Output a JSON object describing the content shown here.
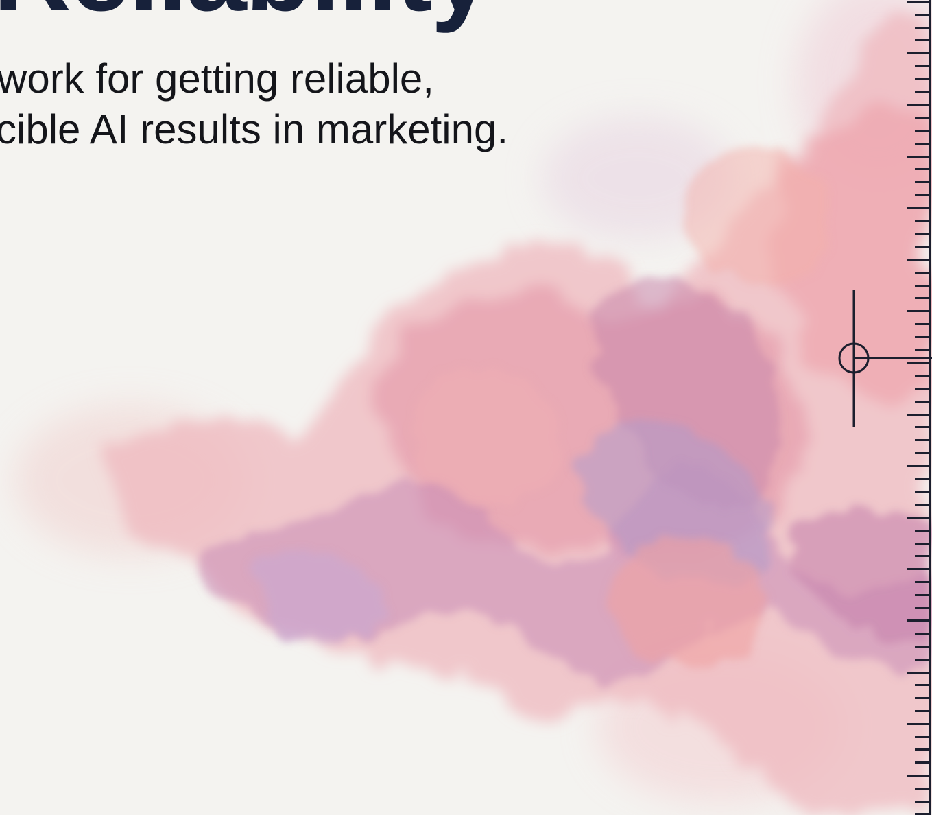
{
  "hero": {
    "title": "Reliability",
    "subtitle_line_1": "work for getting reliable,",
    "subtitle_line_2": "cible AI results in marketing."
  },
  "colors": {
    "background": "#f4f3f0",
    "title": "#17213a",
    "subtitle": "#14151a",
    "watercolor_pink": "#e89aa6",
    "watercolor_mauve": "#c890b4",
    "watercolor_lavender": "#b8a0cc",
    "ruler": "#1c1f2e"
  },
  "icons": {
    "crosshair": "registration-crosshair-icon",
    "ruler": "vertical-ruler"
  }
}
